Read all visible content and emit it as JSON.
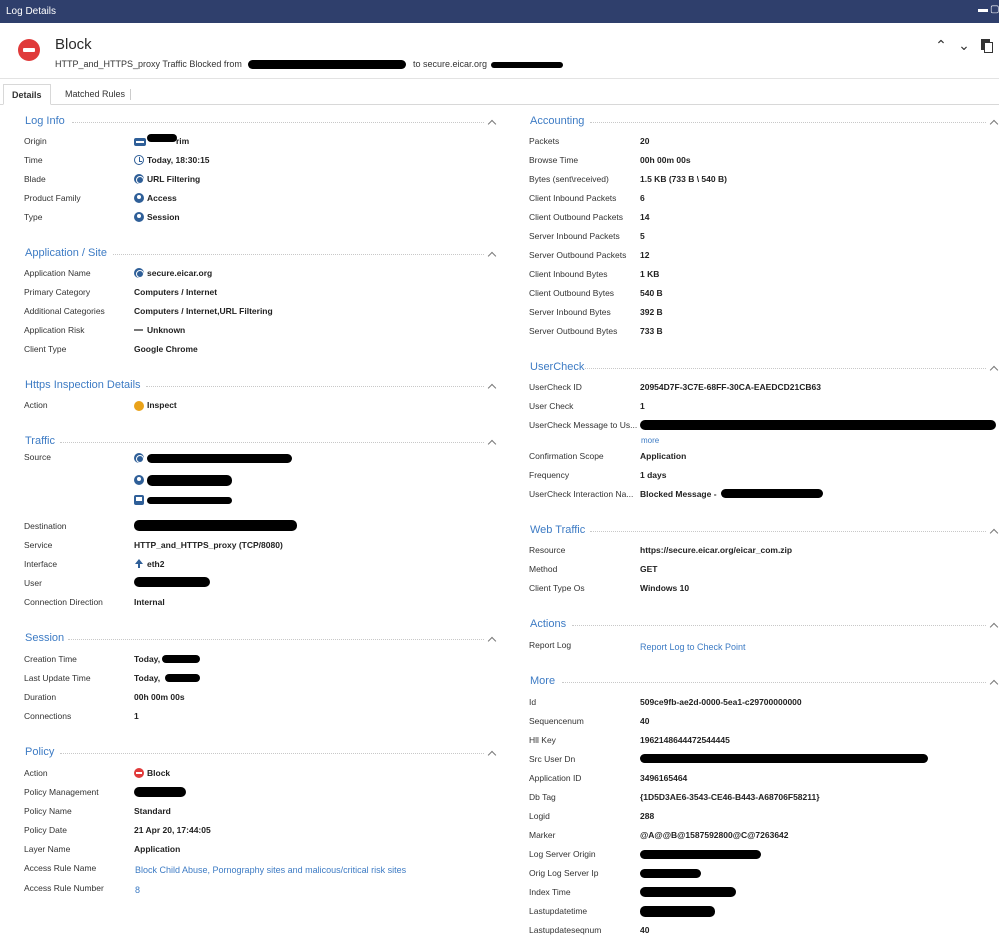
{
  "window": {
    "title": "Log Details"
  },
  "header": {
    "title": "Block",
    "subtitle_prefix": "HTTP_and_HTTPS_proxy Traffic Blocked from",
    "subtitle_mid": "to secure.eicar.org"
  },
  "tabs": [
    {
      "label": "Details",
      "active": true
    },
    {
      "label": "Matched Rules",
      "active": false
    }
  ],
  "log_info": {
    "title": "Log Info",
    "rows": [
      {
        "label": "Origin",
        "value": "rim",
        "icon": "gateway-icon"
      },
      {
        "label": "Time",
        "value": "Today, 18:30:15",
        "icon": "clock-icon"
      },
      {
        "label": "Blade",
        "value": "URL Filtering",
        "icon": "globe-icon"
      },
      {
        "label": "Product Family",
        "value": "Access",
        "icon": "access-icon"
      },
      {
        "label": "Type",
        "value": "Session",
        "icon": "session-icon"
      }
    ]
  },
  "application": {
    "title": "Application / Site",
    "rows": [
      {
        "label": "Application Name",
        "value": "secure.eicar.org"
      },
      {
        "label": "Primary Category",
        "value": "Computers / Internet"
      },
      {
        "label": "Additional Categories",
        "value": "Computers / Internet,URL Filtering"
      },
      {
        "label": "Application Risk",
        "value": "Unknown"
      },
      {
        "label": "Client Type",
        "value": "Google Chrome"
      }
    ]
  },
  "https": {
    "title": "Https Inspection Details",
    "rows": [
      {
        "label": "Action",
        "value": "Inspect"
      }
    ]
  },
  "traffic": {
    "title": "Traffic",
    "source_label": "Source",
    "destination_label": "Destination",
    "service_label": "Service",
    "service_value": "HTTP_and_HTTPS_proxy (TCP/8080)",
    "interface_label": "Interface",
    "interface_value": "eth2",
    "user_label": "User",
    "direction_label": "Connection Direction",
    "direction_value": "Internal"
  },
  "session": {
    "title": "Session",
    "rows": [
      {
        "label": "Creation Time",
        "value": "Today,"
      },
      {
        "label": "Last Update Time",
        "value": "Today,"
      },
      {
        "label": "Duration",
        "value": "00h 00m 00s"
      },
      {
        "label": "Connections",
        "value": "1"
      }
    ]
  },
  "policy": {
    "title": "Policy",
    "rows": [
      {
        "label": "Action",
        "value": "Block"
      },
      {
        "label": "Policy Management",
        "value": ""
      },
      {
        "label": "Policy Name",
        "value": "Standard"
      },
      {
        "label": "Policy Date",
        "value": "21 Apr 20, 17:44:05"
      },
      {
        "label": "Layer Name",
        "value": "Application"
      },
      {
        "label": "Access Rule Name",
        "value": "Block Child Abuse, Pornography sites and malicous/critical risk sites"
      },
      {
        "label": "Access Rule Number",
        "value": "8"
      }
    ]
  },
  "accounting": {
    "title": "Accounting",
    "rows": [
      {
        "label": "Packets",
        "value": "20"
      },
      {
        "label": "Browse Time",
        "value": "00h 00m 00s"
      },
      {
        "label": "Bytes (sent\\received)",
        "value": "1.5 KB (733 B \\ 540 B)"
      },
      {
        "label": "Client Inbound Packets",
        "value": "6"
      },
      {
        "label": "Client Outbound Packets",
        "value": "14"
      },
      {
        "label": "Server Inbound Packets",
        "value": "5"
      },
      {
        "label": "Server Outbound Packets",
        "value": "12"
      },
      {
        "label": "Client Inbound Bytes",
        "value": "1 KB"
      },
      {
        "label": "Client Outbound Bytes",
        "value": "540 B"
      },
      {
        "label": "Server Inbound Bytes",
        "value": "392 B"
      },
      {
        "label": "Server Outbound Bytes",
        "value": "733 B"
      }
    ]
  },
  "usercheck": {
    "title": "UserCheck",
    "rows": [
      {
        "label": "UserCheck ID",
        "value": "20954D7F-3C7E-68FF-30CA-EAEDCD21CB63"
      },
      {
        "label": "User Check",
        "value": "1"
      },
      {
        "label": "UserCheck Message to Us...",
        "value": ""
      },
      {
        "label": "Confirmation Scope",
        "value": "Application"
      },
      {
        "label": "Frequency",
        "value": "1 days"
      },
      {
        "label": "UserCheck Interaction Na...",
        "value": "Blocked Message -"
      }
    ],
    "more_link": "more"
  },
  "web_traffic": {
    "title": "Web Traffic",
    "rows": [
      {
        "label": "Resource",
        "value": "https://secure.eicar.org/eicar_com.zip"
      },
      {
        "label": "Method",
        "value": "GET"
      },
      {
        "label": "Client Type Os",
        "value": "Windows 10"
      }
    ]
  },
  "actions": {
    "title": "Actions",
    "report_label": "Report Log",
    "report_link": "Report Log to Check Point"
  },
  "more": {
    "title": "More",
    "rows": [
      {
        "label": "Id",
        "value": "509ce9fb-ae2d-0000-5ea1-c29700000000"
      },
      {
        "label": "Sequencenum",
        "value": "40"
      },
      {
        "label": "Hll Key",
        "value": "1962148644472544445"
      },
      {
        "label": "Src User Dn",
        "value": ""
      },
      {
        "label": "Application ID",
        "value": "3496165464"
      },
      {
        "label": "Db Tag",
        "value": "{1D5D3AE6-3543-CE46-B443-A68706F58211}"
      },
      {
        "label": "Logid",
        "value": "288"
      },
      {
        "label": "Marker",
        "value": "@A@@B@1587592800@C@7263642"
      },
      {
        "label": "Log Server Origin",
        "value": ""
      },
      {
        "label": "Orig Log Server Ip",
        "value": ""
      },
      {
        "label": "Index Time",
        "value": ""
      },
      {
        "label": "Lastupdatetime",
        "value": ""
      },
      {
        "label": "Lastupdateseqnum",
        "value": "40"
      }
    ]
  }
}
